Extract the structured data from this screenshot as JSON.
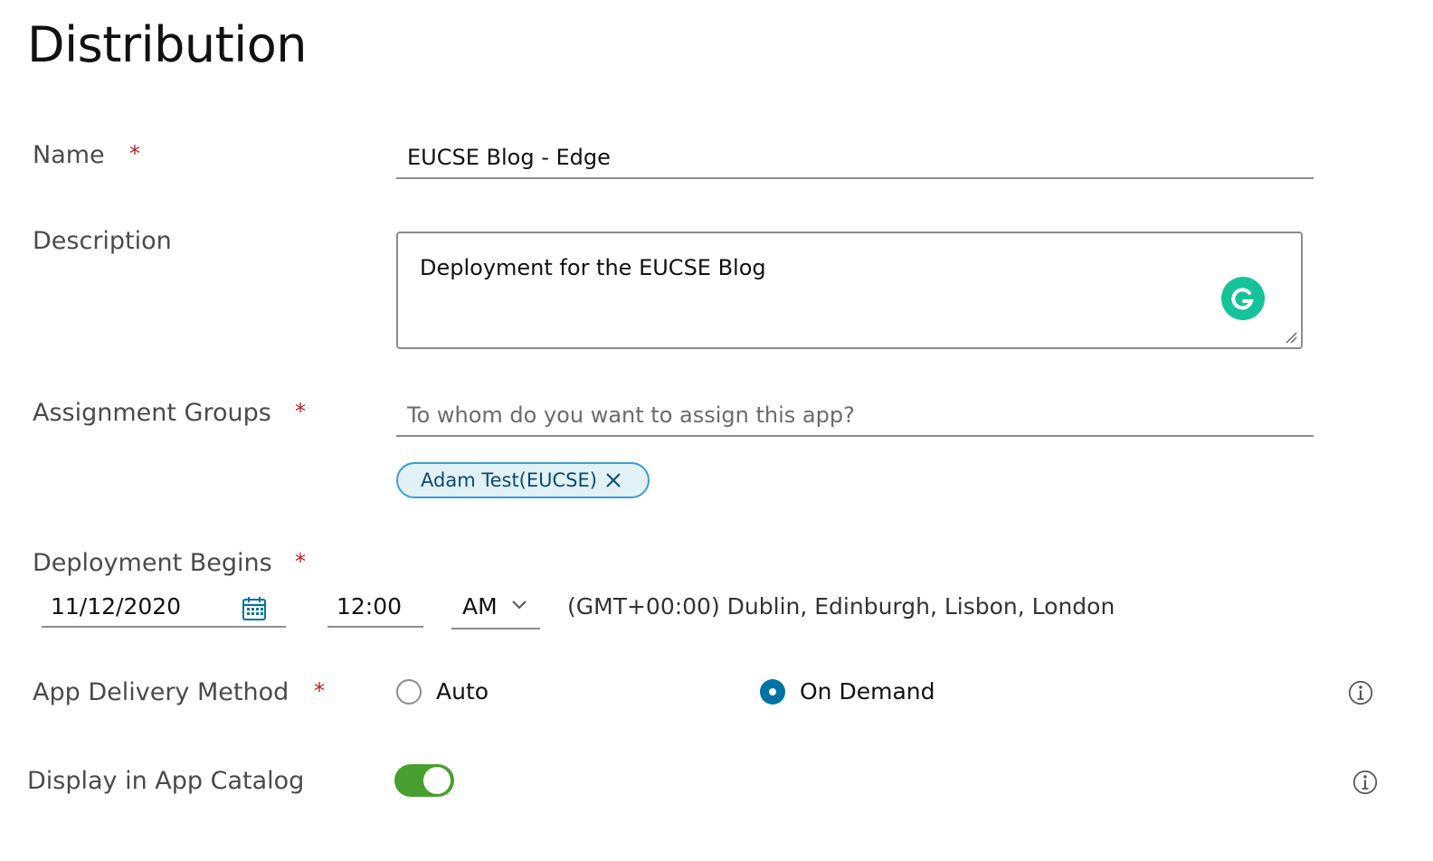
{
  "page": {
    "title": "Distribution"
  },
  "name": {
    "label": "Name",
    "required": "*",
    "value": "EUCSE Blog - Edge"
  },
  "description": {
    "label": "Description",
    "value": "Deployment for the EUCSE Blog"
  },
  "assignment_groups": {
    "label": "Assignment Groups",
    "required": "*",
    "placeholder": "To whom do you want to assign this app?",
    "chips": [
      {
        "label": "Adam Test(EUCSE)"
      }
    ]
  },
  "deployment_begins": {
    "label": "Deployment Begins",
    "required": "*",
    "date": "11/12/2020",
    "time": "12:00",
    "ampm": "AM",
    "timezone": "(GMT+00:00) Dublin, Edinburgh, Lisbon, London"
  },
  "app_delivery_method": {
    "label": "App Delivery Method",
    "required": "*",
    "options": [
      {
        "label": "Auto",
        "selected": false
      },
      {
        "label": "On Demand",
        "selected": true
      }
    ]
  },
  "display_in_catalog": {
    "label": "Display in App Catalog",
    "enabled": true
  },
  "colors": {
    "accent": "#0072a3",
    "toggle_on": "#489e2e",
    "required": "#b0222b",
    "chip_bg": "#e1f1f6",
    "chip_border": "#3b9bd6",
    "grammarly": "#15c39a"
  },
  "icons": {
    "calendar": "calendar-icon",
    "chevron": "chevron-down-icon",
    "info": "info-icon",
    "close": "close-icon",
    "grammarly": "grammarly-icon"
  }
}
